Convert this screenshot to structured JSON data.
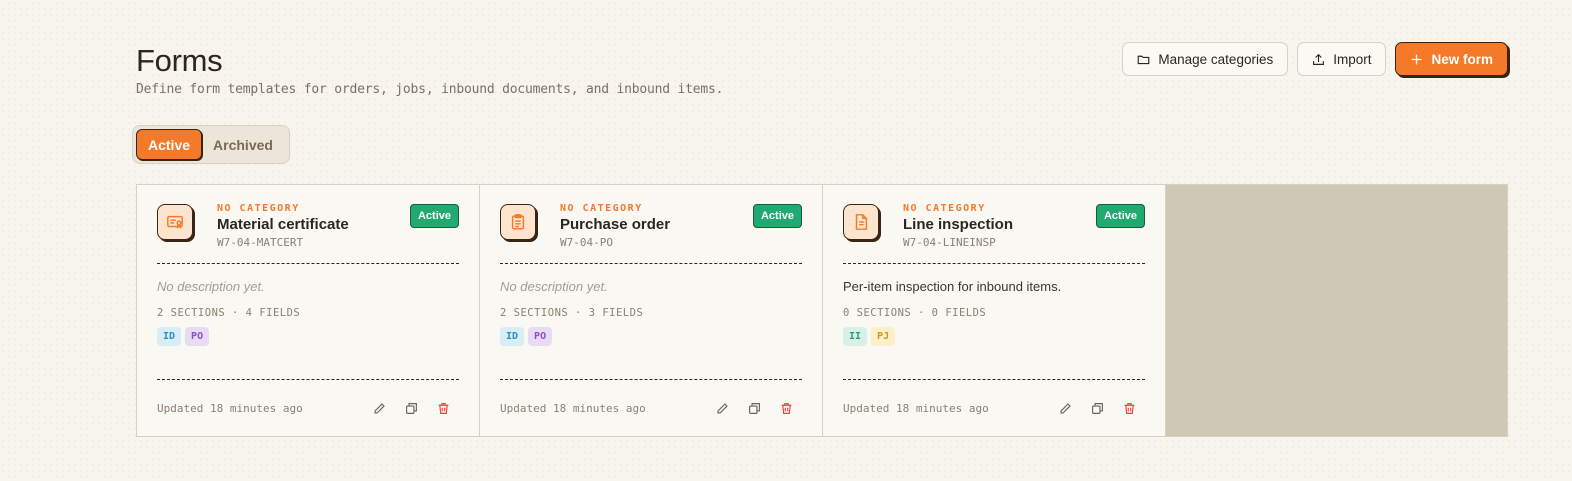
{
  "header": {
    "title": "Forms",
    "subtitle": "Define form templates for orders, jobs, inbound documents, and inbound items."
  },
  "actions": {
    "manage_categories": "Manage categories",
    "import": "Import",
    "new_form": "New form"
  },
  "tabs": [
    {
      "label": "Active",
      "active": true
    },
    {
      "label": "Archived",
      "active": false
    }
  ],
  "colors": {
    "accent": "#f47a2a",
    "active_badge": "#1faa72",
    "delete": "#e0443a",
    "background": "#f8f5ee"
  },
  "cards": [
    {
      "icon": "certificate-icon",
      "category": "NO CATEGORY",
      "title": "Material certificate",
      "code": "W7-04-MATCERT",
      "status": "Active",
      "description": "No description yet.",
      "description_empty": true,
      "meta": "2 SECTIONS · 4 FIELDS",
      "tags": [
        {
          "label": "ID",
          "bg": "#d6eef6",
          "color": "#2a8fb8"
        },
        {
          "label": "PO",
          "bg": "#e8dcf5",
          "color": "#8b4fc4"
        }
      ],
      "updated": "Updated 18 minutes ago"
    },
    {
      "icon": "clipboard-icon",
      "category": "NO CATEGORY",
      "title": "Purchase order",
      "code": "W7-04-PO",
      "status": "Active",
      "description": "No description yet.",
      "description_empty": true,
      "meta": "2 SECTIONS · 3 FIELDS",
      "tags": [
        {
          "label": "ID",
          "bg": "#d6eef6",
          "color": "#2a8fb8"
        },
        {
          "label": "PO",
          "bg": "#e8dcf5",
          "color": "#8b4fc4"
        }
      ],
      "updated": "Updated 18 minutes ago"
    },
    {
      "icon": "document-icon",
      "category": "NO CATEGORY",
      "title": "Line inspection",
      "code": "W7-04-LINEINSP",
      "status": "Active",
      "description": "Per-item inspection for inbound items.",
      "description_empty": false,
      "meta": "0 SECTIONS · 0 FIELDS",
      "tags": [
        {
          "label": "II",
          "bg": "#d8f0e8",
          "color": "#2a9d78"
        },
        {
          "label": "PJ",
          "bg": "#fbefcc",
          "color": "#c99a1c"
        }
      ],
      "updated": "Updated 18 minutes ago"
    }
  ]
}
